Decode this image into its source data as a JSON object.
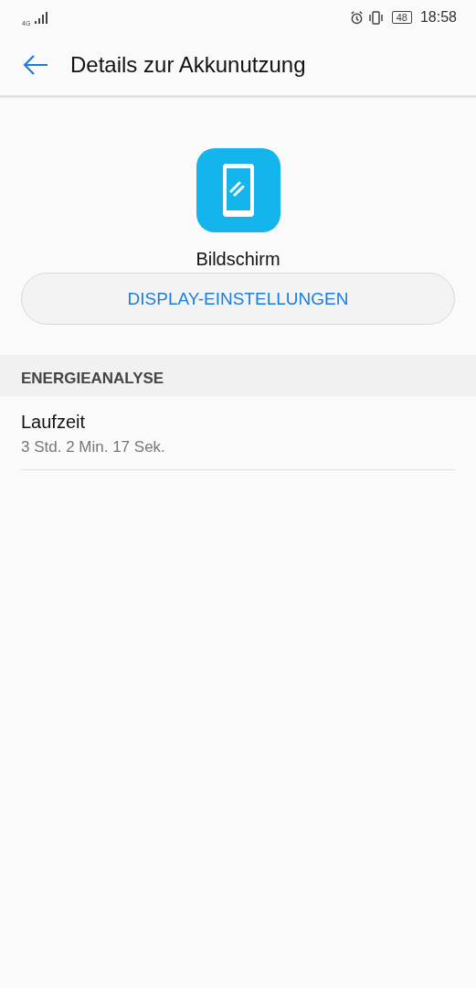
{
  "status_bar": {
    "network": "4G",
    "battery": "48",
    "time": "18:58"
  },
  "header": {
    "title": "Details zur Akkunutzung"
  },
  "app": {
    "name": "Bildschirm",
    "button": "DISPLAY-EINSTELLUNGEN"
  },
  "section": {
    "title": "ENERGIEANALYSE",
    "items": [
      {
        "label": "Laufzeit",
        "value": "3 Std. 2 Min. 17 Sek."
      }
    ]
  }
}
